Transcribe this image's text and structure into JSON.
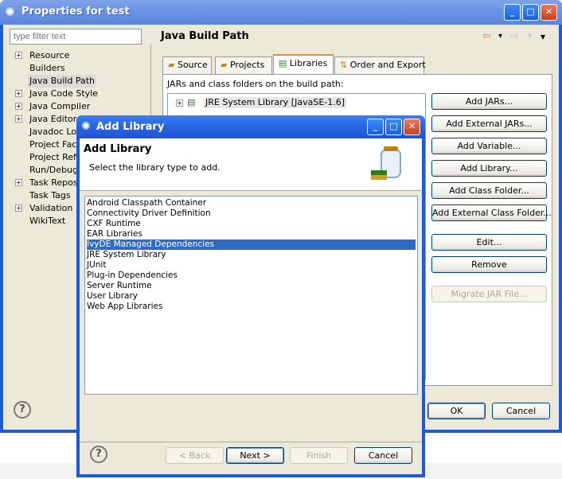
{
  "props_window": {
    "title": "Properties for test",
    "filter_placeholder": "type filter text",
    "tree": [
      {
        "label": "Resource",
        "expandable": true
      },
      {
        "label": "Builders",
        "expandable": false
      },
      {
        "label": "Java Build Path",
        "expandable": false,
        "selected": true
      },
      {
        "label": "Java Code Style",
        "expandable": true
      },
      {
        "label": "Java Compiler",
        "expandable": true
      },
      {
        "label": "Java Editor",
        "expandable": true
      },
      {
        "label": "Javadoc Loca",
        "expandable": false
      },
      {
        "label": "Project Face",
        "expandable": false
      },
      {
        "label": "Project Refe",
        "expandable": false
      },
      {
        "label": "Run/Debug S",
        "expandable": false
      },
      {
        "label": "Task Reposit",
        "expandable": true
      },
      {
        "label": "Task Tags",
        "expandable": false
      },
      {
        "label": "Validation",
        "expandable": true
      },
      {
        "label": "WikiText",
        "expandable": false
      }
    ],
    "panel_title": "Java Build Path",
    "tabs": [
      "Source",
      "Projects",
      "Libraries",
      "Order and Export"
    ],
    "active_tab": "Libraries",
    "jars_label": "JARs and class folders on the build path:",
    "jar_entry": "JRE System Library [JavaSE-1.6]",
    "buttons": {
      "add_jars": "Add JARs...",
      "add_external_jars": "Add External JARs...",
      "add_variable": "Add Variable...",
      "add_library": "Add Library...",
      "add_class_folder": "Add Class Folder...",
      "add_external_class_folder": "Add External Class Folder...",
      "edit": "Edit...",
      "remove": "Remove",
      "migrate": "Migrate JAR File...",
      "ok": "OK",
      "cancel": "Cancel"
    },
    "help_glyph": "?"
  },
  "dialog": {
    "title": "Add Library",
    "heading": "Add Library",
    "instruction": "Select the library type to add.",
    "library_types": [
      "Android Classpath Container",
      "Connectivity Driver Definition",
      "CXF Runtime",
      "EAR Libraries",
      "IvyDE Managed Dependencies",
      "JRE System Library",
      "JUnit",
      "Plug-in Dependencies",
      "Server Runtime",
      "User Library",
      "Web App Libraries"
    ],
    "selected_type": "IvyDE Managed Dependencies",
    "buttons": {
      "back": "< Back",
      "next": "Next >",
      "finish": "Finish",
      "cancel": "Cancel"
    },
    "help_glyph": "?"
  },
  "icons": {
    "window": "eclipse-gear-icon",
    "minimize": "_",
    "maximize": "□",
    "close": "✕",
    "back_arrow": "⇦",
    "forward_arrow": "⇨",
    "dropdown": "▾",
    "expand": "+"
  },
  "colors": {
    "titlebar": "#2764e0",
    "selection": "#316ac5",
    "dialog_bg": "#ece9d8"
  }
}
